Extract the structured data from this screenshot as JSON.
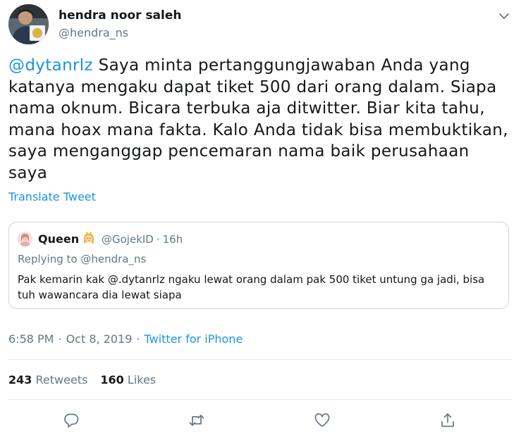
{
  "author": {
    "name": "hendra noor saleh",
    "handle": "@hendra_ns"
  },
  "tweet": {
    "mention": "@dytanrlz",
    "text": " Saya minta pertanggungjawaban Anda yang katanya mengaku dapat tiket 500 dari orang dalam. Siapa nama oknum. Bicara terbuka aja ditwitter. Biar kita tahu, mana hoax mana fakta. Kalo Anda tidak bisa membuktikan, saya menganggap pencemaran nama baik perusahaan saya",
    "translate_label": "Translate Tweet"
  },
  "quoted": {
    "name": "Queen",
    "emoji_icon": "princess-emoji",
    "handle": "@GojekID",
    "dot": "·",
    "age": "16h",
    "replying_to": "Replying to @hendra_ns",
    "text": "Pak kemarin kak @.dytanrlz ngaku lewat orang dalam pak 500 tiket untung ga jadi, bisa tuh wawancara dia lewat siapa"
  },
  "meta": {
    "time": "6:58 PM",
    "dot": "·",
    "date": "Oct 8, 2019",
    "source": "Twitter for iPhone"
  },
  "stats": {
    "retweets_count": "243",
    "retweets_label": "Retweets",
    "likes_count": "160",
    "likes_label": "Likes"
  },
  "actions": [
    "reply-icon",
    "retweet-icon",
    "like-icon",
    "share-icon"
  ],
  "colors": {
    "link": "#1b95e0",
    "secondary_text": "#657786",
    "primary_text": "#14171a",
    "border": "#ccd6dd",
    "divider": "#e6ecf0"
  }
}
